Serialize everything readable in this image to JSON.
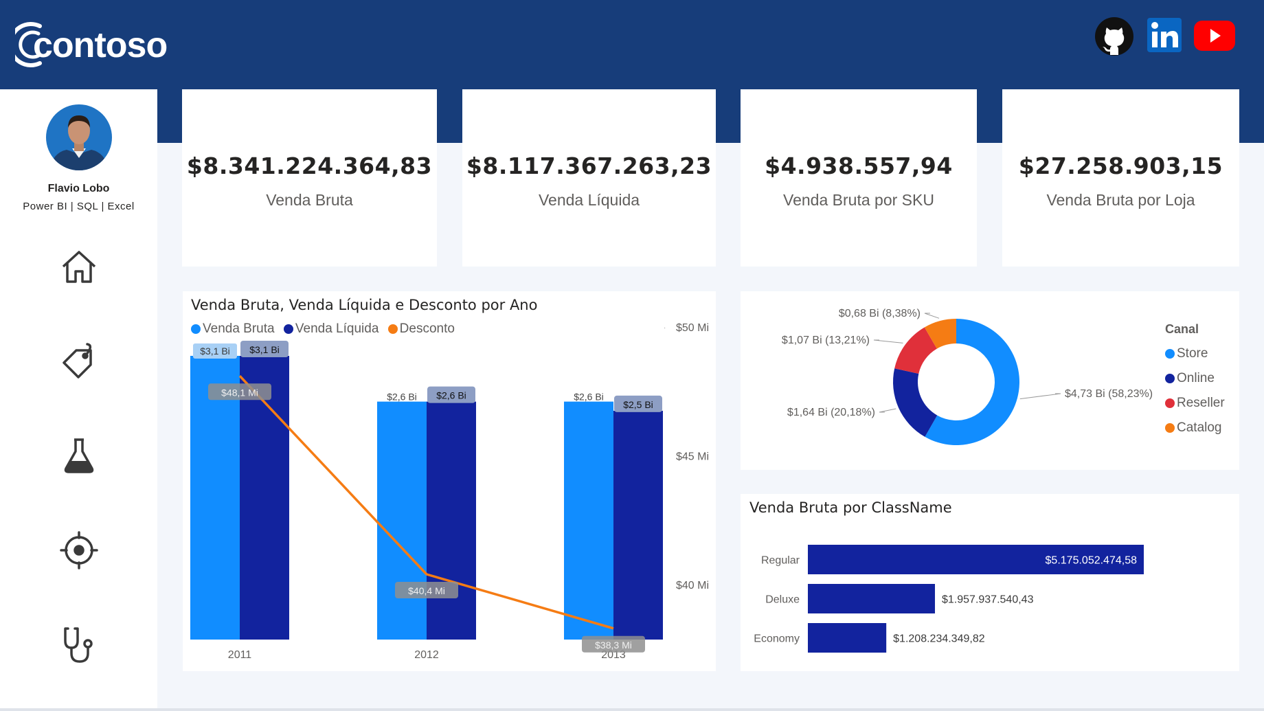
{
  "header": {
    "logo_text": "contoso",
    "social": [
      {
        "icon": "github-icon",
        "label": "GitHub"
      },
      {
        "icon": "linkedin-icon",
        "label": "in"
      },
      {
        "icon": "youtube-icon",
        "label": "YouTube"
      }
    ]
  },
  "profile": {
    "name": "Flavio Lobo",
    "skills": "Power BI | SQL | Excel"
  },
  "nav": [
    {
      "icon": "home-icon"
    },
    {
      "icon": "tag-icon"
    },
    {
      "icon": "flask-icon"
    },
    {
      "icon": "target-icon"
    },
    {
      "icon": "stethoscope-icon"
    }
  ],
  "kpis": [
    {
      "value": "$8.341.224.364,83",
      "label": "Venda Bruta"
    },
    {
      "value": "$8.117.367.263,23",
      "label": "Venda Líquida"
    },
    {
      "value": "$4.938.557,94",
      "label": "Venda Bruta por SKU"
    },
    {
      "value": "$27.258.903,15",
      "label": "Venda Bruta por Loja"
    }
  ],
  "colors": {
    "header": "#173d7a",
    "store": "#118dff",
    "online": "#12239e",
    "reseller": "#e0303a",
    "catalog": "#f57c14"
  },
  "chart_data": [
    {
      "type": "bar",
      "title": "Venda Bruta, Venda Líquida e Desconto por Ano",
      "categories": [
        "2011",
        "2012",
        "2013"
      ],
      "series": [
        {
          "name": "Venda Bruta",
          "values": [
            3.1,
            2.6,
            2.6
          ],
          "labels": [
            "$3,1 Bi",
            "$2,6 Bi",
            "$2,6 Bi"
          ],
          "color": "#118dff"
        },
        {
          "name": "Venda Líquida",
          "values": [
            3.1,
            2.6,
            2.5
          ],
          "labels": [
            "$3,1 Bi",
            "$2,6 Bi",
            "$2,5 Bi"
          ],
          "color": "#12239e"
        },
        {
          "name": "Desconto",
          "type": "line",
          "axis": "secondary",
          "values": [
            48.1,
            40.4,
            38.3
          ],
          "labels": [
            "$48,1 Mi",
            "$40,4 Mi",
            "$38,3 Mi"
          ],
          "color": "#f57c14"
        }
      ],
      "y_secondary_ticks": [
        "$50 Mi",
        "$45 Mi",
        "$40 Mi"
      ],
      "y_secondary_tick_values": [
        50,
        45,
        40
      ],
      "y_secondary_lim": [
        38.0,
        50.0
      ],
      "legend": "top-left"
    },
    {
      "type": "pie",
      "title": "",
      "legend_title": "Canal",
      "legend": "right",
      "labels": [
        "Store",
        "Online",
        "Reseller",
        "Catalog"
      ],
      "values": [
        4.73,
        1.64,
        1.07,
        0.68
      ],
      "data_labels": [
        "$4,73 Bi (58,23%)",
        "$1,64 Bi (20,18%)",
        "$1,07 Bi (13,21%)",
        "$0,68 Bi (8,38%)"
      ],
      "percents": [
        58.23,
        20.18,
        13.21,
        8.38
      ],
      "colors": [
        "#118dff",
        "#12239e",
        "#e0303a",
        "#f57c14"
      ]
    },
    {
      "type": "bar",
      "orientation": "horizontal",
      "title": "Venda Bruta por ClassName",
      "categories": [
        "Regular",
        "Deluxe",
        "Economy"
      ],
      "values": [
        5175052474.58,
        1957937540.43,
        1208234349.82
      ],
      "labels": [
        "$5.175.052.474,58",
        "$1.957.937.540,43",
        "$1.208.234.349,82"
      ],
      "color": "#12239e"
    }
  ]
}
